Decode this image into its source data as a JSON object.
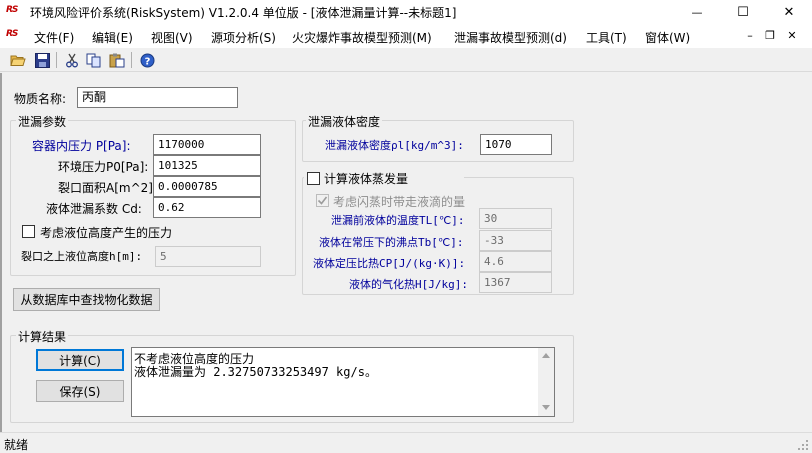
{
  "window": {
    "logo": "RS",
    "title": "环境风险评价系统(RiskSystem) V1.2.0.4 单位版 - [液体泄漏量计算--未标题1]",
    "minimize": "—",
    "maximize": "☐",
    "close": "✕"
  },
  "menu": {
    "logo": "RS",
    "items": [
      "文件(F)",
      "编辑(E)",
      "视图(V)",
      "源项分析(S)",
      "火灾爆炸事故模型预测(M)",
      "泄漏事故模型预测(d)",
      "工具(T)",
      "窗体(W)"
    ],
    "mdi_minimize": "–",
    "mdi_restore": "❐",
    "mdi_close": "✕"
  },
  "toolbar": {
    "icons": [
      "open-folder-icon",
      "save-icon",
      "cut-icon",
      "copy-icon",
      "paste-icon",
      "help-icon"
    ]
  },
  "form": {
    "material_label": "物质名称:",
    "material_value": "丙酮",
    "leak_params": {
      "title": "泄漏参数",
      "container_pressure_label": "容器内压力 P[Pa]:",
      "container_pressure_value": "1170000",
      "ambient_pressure_label": "环境压力P0[Pa]:",
      "ambient_pressure_value": "101325",
      "crack_area_label": "裂口面积A[m^2]:",
      "crack_area_value": "0.0000785",
      "discharge_coef_label": "液体泄漏系数  Cd:",
      "discharge_coef_value": "0.62",
      "consider_level_label": "考虑液位高度产生的压力",
      "level_height_label": "裂口之上液位高度h[m]:",
      "level_height_value": "5"
    },
    "density_group": {
      "title": "泄漏液体密度",
      "density_label": "泄漏液体密度ρl[kg/m^3]:",
      "density_value": "1070"
    },
    "evaporation_group": {
      "title": "计算液体蒸发量",
      "flash_label": "考虑闪蒸时带走液滴的量",
      "temp_label": "泄漏前液体的温度TL[℃]:",
      "temp_value": "30",
      "boiling_label": "液体在常压下的沸点Tb[℃]:",
      "boiling_value": "-33",
      "heat_capacity_label": "液体定压比热CP[J/(kg·K)]:",
      "heat_capacity_value": "4.6",
      "vaporization_label": "液体的气化热H[J/kg]:",
      "vaporization_value": "1367"
    },
    "lookup_button": "从数据库中查找物化数据",
    "results": {
      "title": "计算结果",
      "calc_button": "计算(C)",
      "save_button": "保存(S)",
      "lines": [
        "不考虑液位高度的压力",
        "液体泄漏量为 2.32750733253497 kg/s。"
      ]
    }
  },
  "status": {
    "text": "就绪"
  }
}
